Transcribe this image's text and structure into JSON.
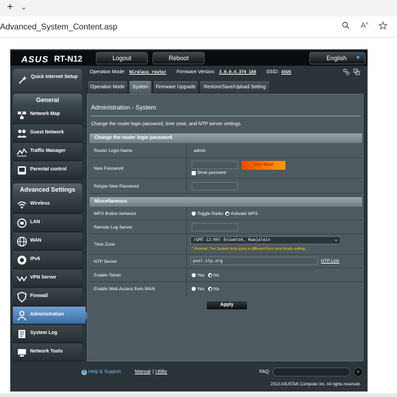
{
  "browser": {
    "tab_plus": "+",
    "tab_chevron": "⌄",
    "url": "Advanced_System_Content.asp",
    "icons": [
      "zoom-icon",
      "star-icon",
      "read-aloud-icon"
    ]
  },
  "header": {
    "logo": "ASUS",
    "model": "RT-N12",
    "logout": "Logout",
    "reboot": "Reboot",
    "language": "English"
  },
  "sidebar": {
    "quick_setup": "Quick Internet Setup",
    "general_header": "General",
    "general_items": [
      {
        "label": "Network Map",
        "icon": "network-map-icon"
      },
      {
        "label": "Guest Network",
        "icon": "guest-network-icon"
      },
      {
        "label": "Traffic Manager",
        "icon": "traffic-manager-icon"
      },
      {
        "label": "Parental control",
        "icon": "parental-control-icon"
      }
    ],
    "advanced_header": "Advanced Settings",
    "advanced_items": [
      {
        "label": "Wireless",
        "icon": "wireless-icon"
      },
      {
        "label": "LAN",
        "icon": "lan-icon"
      },
      {
        "label": "WAN",
        "icon": "wan-icon"
      },
      {
        "label": "IPv6",
        "icon": "ipv6-icon"
      },
      {
        "label": "VPN Server",
        "icon": "vpn-icon"
      },
      {
        "label": "Firewall",
        "icon": "firewall-icon"
      },
      {
        "label": "Administration",
        "icon": "administration-icon",
        "active": true
      },
      {
        "label": "System Log",
        "icon": "system-log-icon"
      },
      {
        "label": "Network Tools",
        "icon": "network-tools-icon"
      }
    ]
  },
  "info": {
    "mode_label": "Operation Mode:",
    "mode_value": "Wireless router",
    "fw_label": "Firmware Version:",
    "fw_value": "3.0.0.4.374_168",
    "ssid_label": "SSID:",
    "ssid_value": "ASUS"
  },
  "tabs": [
    "Operation Mode",
    "System",
    "Firmware Upgrade",
    "Restore/Save/Upload Setting"
  ],
  "panel": {
    "title": "Administration - System",
    "description": "Change the router login password, time zone, and NTP server settings.",
    "group1": "Change the router login password",
    "group2": "Miscellaneous",
    "rows": {
      "login_name_label": "Router Login Name",
      "login_name_value": "admin",
      "new_password_label": "New Password",
      "strength": "Very Weak",
      "show_password": "Show password",
      "retype_label": "Retype New Password",
      "wps_label": "WPS Button behavior",
      "wps_opt1": "Toggle Radio",
      "wps_opt2": "Activate WPS",
      "remote_log_label": "Remote Log Server",
      "timezone_label": "Time Zone",
      "timezone_value": "(GMT-12:00) Eniwetok, Kwajalein",
      "timezone_remind": "* Remind: The System time zone is different from your locale setting.",
      "ntp_label": "NTP Server",
      "ntp_value": "pool.ntp.org",
      "ntp_link": "NTP Link",
      "telnet_label": "Enable Telnet",
      "web_wan_label": "Enable Web Access from WAN",
      "yes": "Yes",
      "no": "No"
    },
    "apply": "Apply"
  },
  "footer": {
    "help": "Help & Support",
    "manual": "Manual",
    "separator": "|",
    "utility": "Utility",
    "faq": "FAQ",
    "copyright": "2013 ASUSTeK Computer Inc. All rights reserved."
  }
}
